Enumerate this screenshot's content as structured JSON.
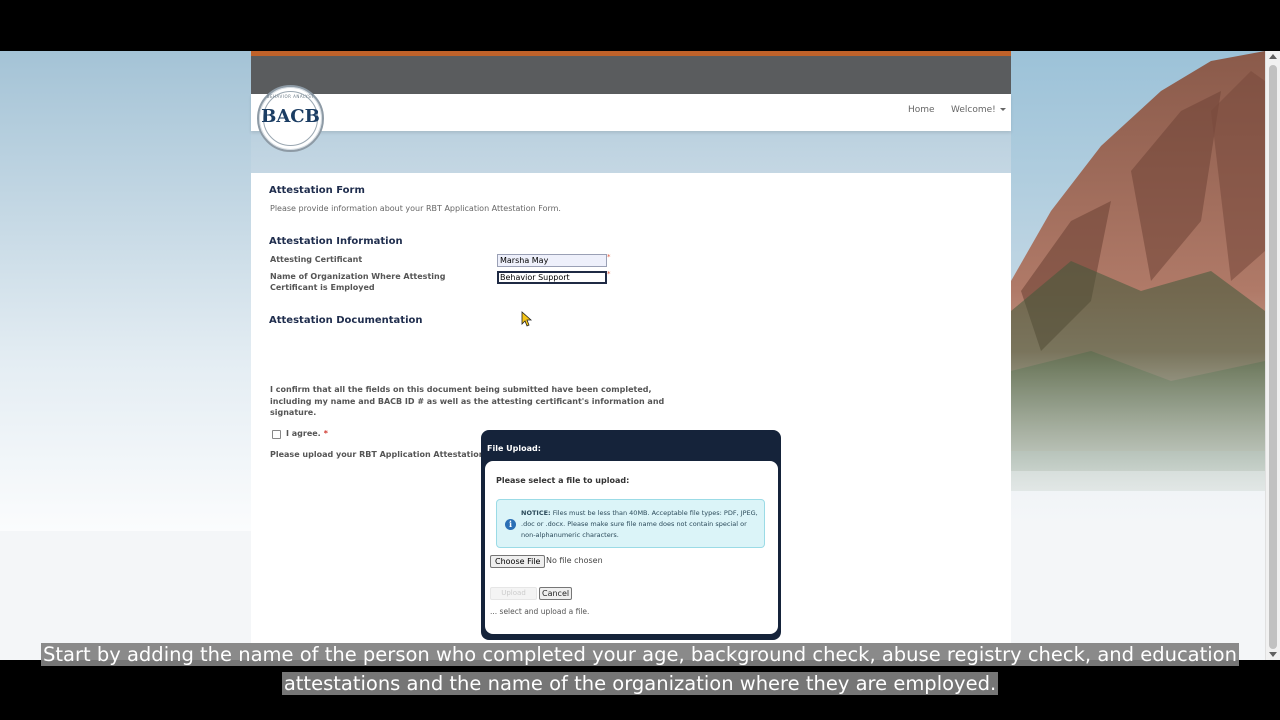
{
  "nav": {
    "home": "Home",
    "welcome": "Welcome!"
  },
  "logo": {
    "text": "BACB",
    "ring_top": "BEHAVIOR ANALYST",
    "ring_bottom": "CERTIFICATION BOARD"
  },
  "form": {
    "title": "Attestation Form",
    "subtitle": "Please provide information about your RBT Application Attestation Form.",
    "info_title": "Attestation Information",
    "attesting_label": "Attesting Certificant",
    "attesting_value": "Marsha May",
    "org_label": "Name of Organization Where Attesting Certificant is Employed",
    "org_value": "Behavior Support",
    "required_mark": "*",
    "doc_title": "Attestation Documentation",
    "confirm_text": "I confirm that all the fields on this document being submitted have been completed, including my name and BACB ID # as well as the attesting certificant's information and signature.",
    "agree_label": "I agree.",
    "upload_instruction": "Please upload your RBT Application Attestation. Please only upload one file."
  },
  "modal": {
    "title": "File Upload:",
    "prompt": "Please select a file to upload:",
    "notice_bold": "NOTICE:",
    "notice_text": "Files must be less than 40MB. Acceptable file types: PDF, JPEG, .doc or .docx. Please make sure file name does not contain special or non-alphanumeric characters.",
    "choose_file": "Choose File",
    "no_file": "No file chosen",
    "upload": "Upload",
    "cancel": "Cancel",
    "status": "... select and upload a file."
  },
  "caption": {
    "line1": "Start by adding the name of the person who completed your age, background check, abuse registry check, and education",
    "line2": "attestations and the name of the organization where they are employed."
  }
}
